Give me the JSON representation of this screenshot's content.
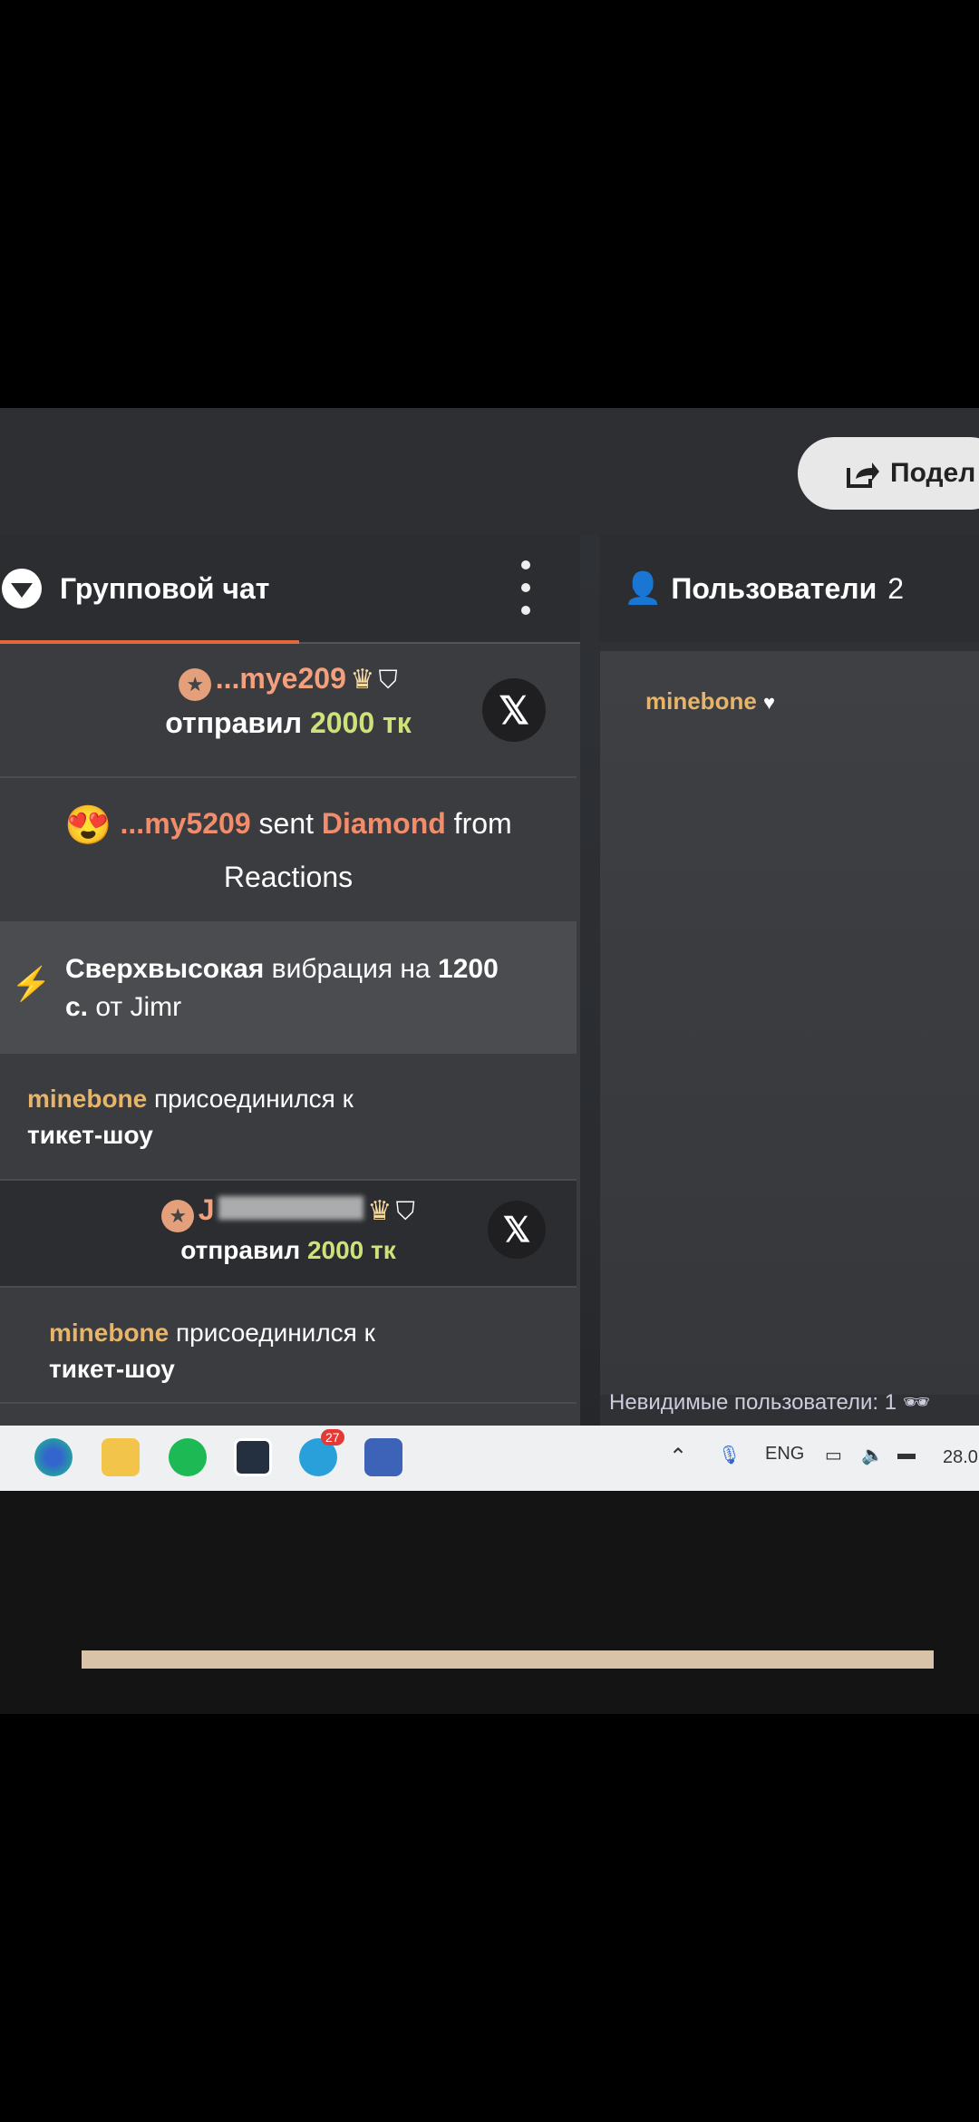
{
  "share": {
    "label": "Подел"
  },
  "chat": {
    "title": "Групповой чат",
    "messages": [
      {
        "type": "gift",
        "user": "...mye209",
        "text": "отправил",
        "amount": "2000 тк"
      },
      {
        "type": "reaction",
        "user": "...my5209",
        "sent": "sent",
        "item": "Diamond",
        "from": "from",
        "source": "Reactions"
      },
      {
        "type": "vibration",
        "highlight": "Сверхвысокая",
        "text": "вибрация на",
        "amount": "1200",
        "unit": "с.",
        "from": "от Jimr"
      },
      {
        "type": "join",
        "user": "minebone",
        "text": "присоединился к",
        "room": "тикет-шоу"
      },
      {
        "type": "gift",
        "user": "J",
        "text": "отправил",
        "amount": "2000 тк"
      },
      {
        "type": "join",
        "user": "minebone",
        "text": "присоединился к",
        "room": "тикет-шоу"
      }
    ]
  },
  "users": {
    "title": "Пользователи",
    "count": "2",
    "list": [
      {
        "name": "minebone"
      }
    ],
    "invisible": "Невидимые пользователи: 1"
  },
  "taskbar": {
    "lang": "ENG",
    "date": "28.0",
    "telegram_badge": "27",
    "icons": [
      "edge-icon",
      "file-explorer-icon",
      "spotify-icon",
      "app-icon",
      "telegram-icon",
      "app2-icon"
    ]
  },
  "colors": {
    "accent": "#e4683e",
    "username": "#e6b46a",
    "amount": "#cde37a"
  }
}
